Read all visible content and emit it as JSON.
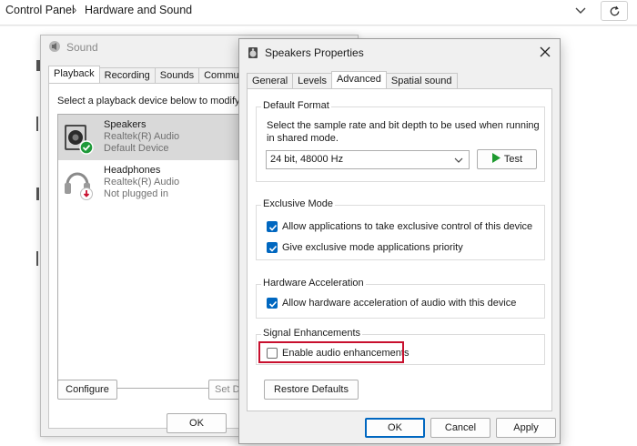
{
  "control_panel": {
    "breadcrumb": [
      "Control Panel",
      "Hardware and Sound"
    ],
    "separator": "›"
  },
  "sound_dialog": {
    "title": "Sound",
    "tabs": [
      "Playback",
      "Recording",
      "Sounds",
      "Communications"
    ],
    "active_tab": "Playback",
    "instruction": "Select a playback device below to modify its settings:",
    "devices": [
      {
        "name": "Speakers",
        "driver": "Realtek(R) Audio",
        "status": "Default Device",
        "selected": true,
        "badge": "check-icon"
      },
      {
        "name": "Headphones",
        "driver": "Realtek(R) Audio",
        "status": "Not plugged in",
        "selected": false,
        "badge": "unplugged-icon"
      }
    ],
    "configure_label": "Configure",
    "set_default_label": "Set Default",
    "ok_label": "OK"
  },
  "speakers_properties": {
    "title": "Speakers Properties",
    "tabs": [
      "General",
      "Levels",
      "Advanced",
      "Spatial sound"
    ],
    "active_tab": "Advanced",
    "default_format": {
      "label": "Default Format",
      "description": "Select the sample rate and bit depth to be used when running in shared mode.",
      "selected": "24 bit, 48000 Hz",
      "test_label": "Test"
    },
    "exclusive_mode": {
      "label": "Exclusive Mode",
      "options": [
        {
          "label": "Allow applications to take exclusive control of this device",
          "checked": true
        },
        {
          "label": "Give exclusive mode applications priority",
          "checked": true
        }
      ]
    },
    "hardware_acceleration": {
      "label": "Hardware Acceleration",
      "option": {
        "label": "Allow hardware acceleration of audio with this device",
        "checked": true
      }
    },
    "signal_enhancements": {
      "label": "Signal Enhancements",
      "option": {
        "label": "Enable audio enhancements",
        "checked": false
      }
    },
    "restore_defaults_label": "Restore Defaults",
    "ok_label": "OK",
    "cancel_label": "Cancel",
    "apply_label": "Apply"
  },
  "colors": {
    "accent": "#0067c0",
    "highlight": "#c8102e",
    "selected_row": "#d9d9d9",
    "test_arrow": "#1e9a2f"
  }
}
